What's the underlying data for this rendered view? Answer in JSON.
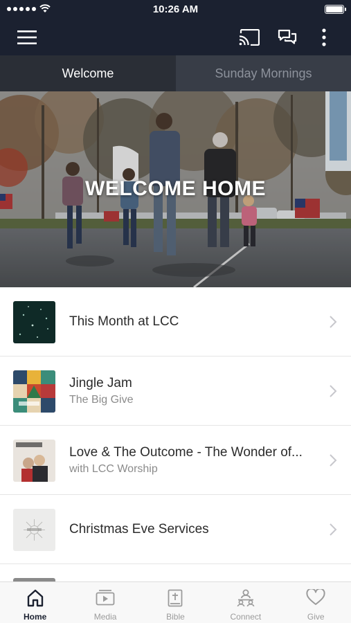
{
  "status_bar": {
    "time": "10:26 AM"
  },
  "nav": {
    "icons": [
      "menu-icon",
      "cast-icon",
      "chat-icon",
      "more-icon"
    ]
  },
  "tabs": [
    {
      "label": "Welcome",
      "active": true
    },
    {
      "label": "Sunday Mornings",
      "active": false
    }
  ],
  "hero": {
    "title": "WELCOME HOME"
  },
  "list": [
    {
      "title": "This Month at LCC",
      "subtitle": ""
    },
    {
      "title": "Jingle Jam",
      "subtitle": "The Big Give"
    },
    {
      "title": "Love & The Outcome - The Wonder of...",
      "subtitle": "with LCC Worship"
    },
    {
      "title": "Christmas Eve Services",
      "subtitle": ""
    }
  ],
  "tab_bar": [
    {
      "label": "Home",
      "icon": "home-icon",
      "active": true
    },
    {
      "label": "Media",
      "icon": "media-icon",
      "active": false
    },
    {
      "label": "Bible",
      "icon": "bible-icon",
      "active": false
    },
    {
      "label": "Connect",
      "icon": "connect-icon",
      "active": false
    },
    {
      "label": "Give",
      "icon": "heart-icon",
      "active": false
    }
  ],
  "colors": {
    "header_bg": "#1b2130",
    "tab_active_bg": "#2a2e36",
    "tab_inactive_bg": "#383d47",
    "tab_bar_active": "#1b2130",
    "tab_bar_inactive": "#9b9b9b"
  }
}
